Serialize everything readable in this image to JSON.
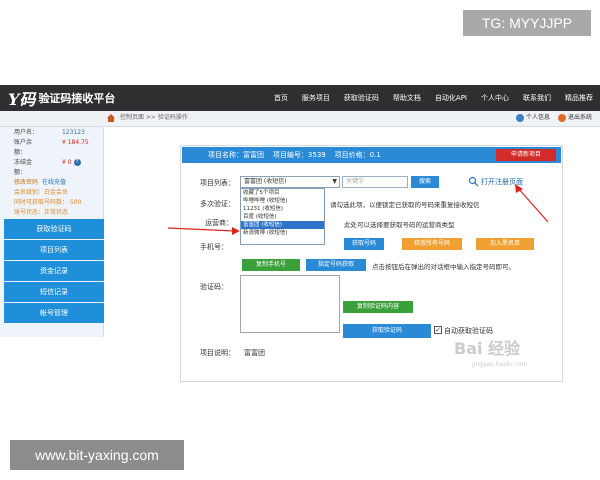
{
  "overlays": {
    "tg_badge": "TG: MYYJJPP",
    "site_url": "www.bit-yaxing.com"
  },
  "header": {
    "logo_mark": "Y码",
    "logo_text": "验证码接收平台",
    "nav": [
      "首页",
      "服务项目",
      "获取验证码",
      "帮助文档",
      "自动化API",
      "个人中心",
      "联系我们",
      "精品推荐"
    ]
  },
  "subbar": {
    "breadcrumb": "控制页面 >> 验证码操作",
    "links": [
      "个人信息",
      "退出系统"
    ]
  },
  "user": {
    "username_label": "用户名：",
    "username": "123123",
    "balance_label": "账户余额：",
    "balance": "¥ 184.75",
    "credit_label": "冻结金额：",
    "credit": "¥ 0",
    "links": [
      "修改密码",
      "在线充值"
    ],
    "level": "会员级别：白金会员",
    "concurrent": "同时可获取号码数： 500",
    "status": "账号状态：正常状态"
  },
  "sidebar_menu": [
    "获取验证码",
    "项目列表",
    "资金记录",
    "短信记录",
    "帐号管理"
  ],
  "panel": {
    "project_name": "项目名称：富富团",
    "project_id": "项目编号：3539",
    "project_price": "项目价格：0.1",
    "apply_button": "申请新项目",
    "project_list_label": "项目列表：",
    "selected_project": "富富团 (收短信)",
    "dropdown_options": [
      "收藏了5个项目",
      "哔哩哔哩 (收短信)",
      "11231 (收短信)",
      "百度 (收短信)",
      "富富团 (收短信)",
      "新浪微博 (收短信)"
    ],
    "dropdown_selected_index": 4,
    "search_placeholder": "关键字",
    "search_button": "搜索",
    "open_register_link": "打开注册页面",
    "multi_verify_label": "多次验证：",
    "multi_verify_text": "请勾选此项，以便锁定已获取的号码来重复接收短信",
    "operator_label": "运营商：",
    "operator_text": "此处可以选择要获取号码的运营商类型",
    "phone_label": "手机号：",
    "get_number_button": "获取号码",
    "release_number_button": "释放所有号码",
    "blacklist_button": "加入黑名单",
    "copy_phone_button": "复制手机号",
    "specify_number_button": "指定号码获取",
    "specify_tip": "点击按钮后在弹出的对话框中输入指定号码即可。",
    "code_label": "验证码：",
    "copy_code_button": "复制验证码内容",
    "get_code_button": "获取验证码",
    "auto_get_label": "自动获取验证码",
    "auto_get_checked": true,
    "description_label": "项目说明：",
    "description_value": "富富团"
  },
  "watermark": {
    "logo": "Bai 经验",
    "sub": "jingyan.baidu.com"
  },
  "colors": {
    "header_bg": "#2f2f2f",
    "primary_blue": "#2a8ad6",
    "apply_red": "#d32a2a",
    "button_green": "#3aa03a",
    "button_orange": "#f0a030",
    "annotation_arrow": "#d9261c"
  }
}
